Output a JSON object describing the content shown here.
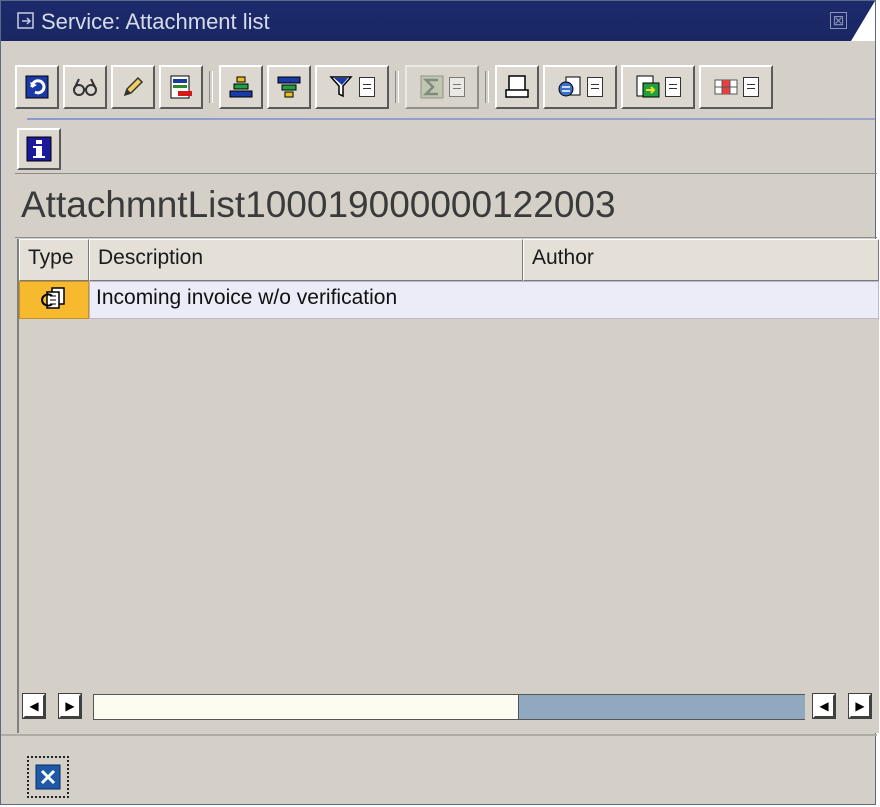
{
  "window": {
    "title": "Service: Attachment list",
    "close_glyph": "⊠"
  },
  "toolbar": {
    "buttons": [
      {
        "name": "refresh-icon"
      },
      {
        "name": "display-glasses-icon"
      },
      {
        "name": "edit-pencil-icon"
      },
      {
        "name": "delete-icon"
      },
      {
        "name": "sort-ascending-icon"
      },
      {
        "name": "sort-descending-icon"
      },
      {
        "name": "filter-icon"
      },
      {
        "name": "sum-icon"
      },
      {
        "name": "print-preview-icon"
      },
      {
        "name": "view-icon"
      },
      {
        "name": "export-icon"
      },
      {
        "name": "layout-icon"
      }
    ],
    "info_icon": "info-icon"
  },
  "list": {
    "title": "AttachmntList100019000000122003",
    "columns": [
      "Type",
      "Description",
      "Author"
    ],
    "rows": [
      {
        "type_icon": "document-copy-icon",
        "description": "Incoming invoice w/o verification",
        "author": ""
      }
    ]
  },
  "footer": {
    "cancel_icon": "cancel-x-icon"
  },
  "colors": {
    "titlebar": "#1c2a6c",
    "window_bg": "#d4d0c8",
    "selected_type_cell": "#f7b92e",
    "row_bg": "#ececf8",
    "scroll_thumb": "#90a8c0"
  }
}
